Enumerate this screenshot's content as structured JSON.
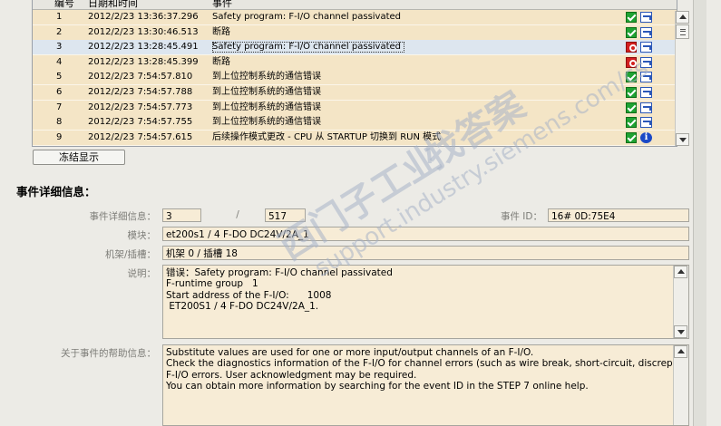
{
  "table": {
    "headers": {
      "no": "编号",
      "datetime": "日期和时间",
      "event": "事件"
    },
    "rows": [
      {
        "no": "1",
        "datetime": "2012/2/23 13:36:37.296",
        "event": "Safety program: F-I/O channel passivated",
        "status": "ok",
        "action": "open"
      },
      {
        "no": "2",
        "datetime": "2012/2/23 13:30:46.513",
        "event": "断路",
        "status": "ok",
        "action": "open"
      },
      {
        "no": "3",
        "datetime": "2012/2/23 13:28:45.491",
        "event": "Safety program: F-I/O channel passivated",
        "status": "error",
        "action": "open",
        "selected": true
      },
      {
        "no": "4",
        "datetime": "2012/2/23 13:28:45.399",
        "event": "断路",
        "status": "error",
        "action": "open"
      },
      {
        "no": "5",
        "datetime": "2012/2/23 7:54:57.810",
        "event": "到上位控制系统的通信错误",
        "status": "ok",
        "action": "open"
      },
      {
        "no": "6",
        "datetime": "2012/2/23 7:54:57.788",
        "event": "到上位控制系统的通信错误",
        "status": "ok",
        "action": "open"
      },
      {
        "no": "7",
        "datetime": "2012/2/23 7:54:57.773",
        "event": "到上位控制系统的通信错误",
        "status": "ok",
        "action": "open"
      },
      {
        "no": "8",
        "datetime": "2012/2/23 7:54:57.755",
        "event": "到上位控制系统的通信错误",
        "status": "ok",
        "action": "open"
      },
      {
        "no": "9",
        "datetime": "2012/2/23 7:54:57.615",
        "event": "后续操作模式更改 - CPU 从 STARTUP 切换到 RUN 模式",
        "status": "ok",
        "action": "info"
      }
    ]
  },
  "freeze_button": "冻结显示",
  "details": {
    "title": "事件详细信息：",
    "detail_info_label": "事件详细信息：",
    "detail_index": "3",
    "detail_sep": "/",
    "detail_total": "517",
    "event_id_label": "事件 ID：",
    "event_id": "16# 0D:75E4",
    "module_label": "模块：",
    "module": "et200s1 / 4 F-DO DC24V/2A_1",
    "rack_slot_label": "机架/插槽：",
    "rack_slot": "机架 0 / 插槽 18",
    "description_label": "说明：",
    "description": "错误：Safety program: F-I/O channel passivated\nF-runtime group   1\nStart address of the F-I/O:      1008\n ET200S1 / 4 F-DO DC24V/2A_1.",
    "help_label": "关于事件的帮助信息：",
    "help": "Substitute values are used for one or more input/output channels of an F-I/O.\nCheck the diagnostics information of the F-I/O for channel errors (such as wire break, short-circuit, discrepancy error) or\nF-I/O errors. User acknowledgment may be required.\nYou can obtain more information by searching for the event ID in the STEP 7 online help."
  },
  "watermark": {
    "line1": "西门子工业",
    "line2": "找答案",
    "line3": "support.industry.siemens.com/cs"
  },
  "colors": {
    "row_bg": "#f4e5c6",
    "selected_row_bg": "#dde6ef",
    "ok": "#1fa233",
    "error": "#d22020",
    "info": "#1b49c6"
  },
  "icons": {
    "ok": "check-icon",
    "error": "error-icon",
    "open": "open-in-editor-icon",
    "info": "info-icon"
  }
}
